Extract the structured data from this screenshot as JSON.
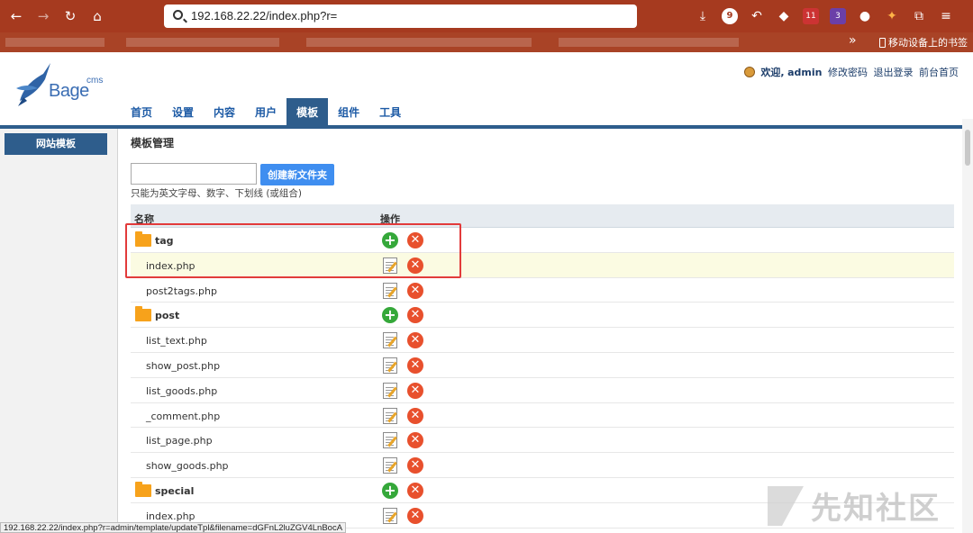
{
  "browser": {
    "url": "192.168.22.22/index.php?r=",
    "mobile_bookmarks": "移动设备上的书签",
    "badge_count": "9",
    "ext_badge_1": "11",
    "ext_badge_2": "3"
  },
  "header": {
    "logo_cms": "cms",
    "logo_bage": "Bage",
    "welcome": "欢迎,",
    "username": "admin",
    "links": [
      "修改密码",
      "退出登录",
      "前台首页"
    ]
  },
  "nav": {
    "tabs": [
      {
        "label": "首页",
        "active": false
      },
      {
        "label": "设置",
        "active": false
      },
      {
        "label": "内容",
        "active": false
      },
      {
        "label": "用户",
        "active": false
      },
      {
        "label": "模板",
        "active": true
      },
      {
        "label": "组件",
        "active": false
      },
      {
        "label": "工具",
        "active": false
      }
    ]
  },
  "sidebar": {
    "items": [
      {
        "label": "网站模板"
      }
    ]
  },
  "main": {
    "title": "模板管理",
    "folder_input_value": "",
    "create_button": "创建新文件夹",
    "hint": "只能为英文字母、数字、下划线 (或组合)",
    "columns": {
      "name": "名称",
      "actions": "操作"
    },
    "rows": [
      {
        "type": "folder",
        "name": "tag",
        "highlight": false
      },
      {
        "type": "file",
        "name": "index.php",
        "highlight": true
      },
      {
        "type": "file",
        "name": "post2tags.php",
        "highlight": false
      },
      {
        "type": "folder",
        "name": "post",
        "highlight": false
      },
      {
        "type": "file",
        "name": "list_text.php",
        "highlight": false
      },
      {
        "type": "file",
        "name": "show_post.php",
        "highlight": false
      },
      {
        "type": "file",
        "name": "list_goods.php",
        "highlight": false
      },
      {
        "type": "file",
        "name": "_comment.php",
        "highlight": false
      },
      {
        "type": "file",
        "name": "list_page.php",
        "highlight": false
      },
      {
        "type": "file",
        "name": "show_goods.php",
        "highlight": false
      },
      {
        "type": "folder",
        "name": "special",
        "highlight": false
      },
      {
        "type": "file",
        "name": "index.php",
        "highlight": false
      }
    ]
  },
  "status_url": "192.168.22.22/index.php?r=admin/template/updateTpl&filename=dGFnL2luZGV4LnBocA",
  "watermark": "先知社区",
  "colors": {
    "chrome": "#a63a1f",
    "nav_active": "#2e5d8c",
    "button": "#3f8ef0",
    "add_icon": "#35a83a",
    "delete_icon": "#e8502d",
    "highlight_box": "#e23b3b"
  },
  "icons": {
    "add": "plus-circle-icon",
    "edit": "edit-file-icon",
    "delete": "delete-x-icon",
    "folder": "folder-icon"
  }
}
